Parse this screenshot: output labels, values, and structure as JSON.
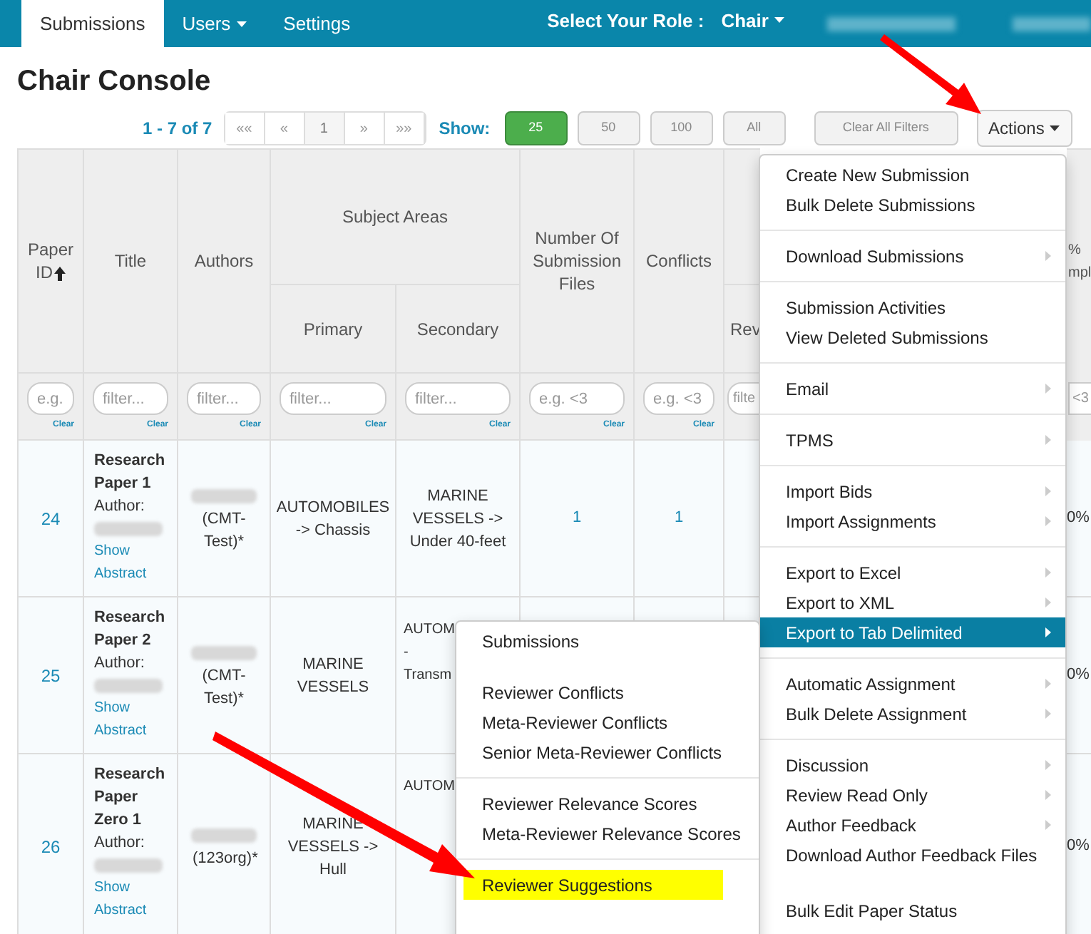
{
  "nav": {
    "tabs": [
      {
        "label": "Submissions",
        "selected": true,
        "dropdown": false
      },
      {
        "label": "Users",
        "selected": false,
        "dropdown": true
      },
      {
        "label": "Settings",
        "selected": false,
        "dropdown": false
      }
    ],
    "role_label": "Select Your Role :",
    "role_value": "Chair"
  },
  "title": "Chair Console",
  "toolbar": {
    "range": "1 - 7 of 7",
    "pager": [
      {
        "label": "««",
        "selected": false
      },
      {
        "label": "«",
        "selected": false
      },
      {
        "label": "1",
        "selected": true
      },
      {
        "label": "»",
        "selected": false
      },
      {
        "label": "»»",
        "selected": false
      }
    ],
    "show_label": "Show:",
    "sizes": [
      {
        "label": "25",
        "selected": true
      },
      {
        "label": "50",
        "selected": false
      },
      {
        "label": "100",
        "selected": false
      },
      {
        "label": "All",
        "selected": false
      }
    ],
    "clear_filters": "Clear All Filters",
    "actions": "Actions"
  },
  "table": {
    "headers": {
      "paper_id": "Paper ID",
      "title": "Title",
      "authors": "Authors",
      "subject_areas": "Subject Areas",
      "primary": "Primary",
      "secondary": "Secondary",
      "files": "Number Of Submission Files",
      "conflicts": "Conflicts",
      "column_8": "Rev"
    },
    "filters": [
      {
        "placeholder": "e.g.",
        "clear": "Clear"
      },
      {
        "placeholder": "filter...",
        "clear": "Clear"
      },
      {
        "placeholder": "filter...",
        "clear": "Clear"
      },
      {
        "placeholder": "filter...",
        "clear": "Clear"
      },
      {
        "placeholder": "filter...",
        "clear": "Clear"
      },
      {
        "placeholder": "e.g. <3",
        "clear": "Clear"
      },
      {
        "placeholder": "e.g. <3",
        "clear": "Clear"
      },
      {
        "placeholder": "filte"
      }
    ],
    "rows": [
      {
        "id": "24",
        "title": "Research Paper 1",
        "author_label": "Author:",
        "abstract_link": "Show Abstract",
        "authors_suffix": "(CMT-Test)*",
        "primary": "AUTOMOBILES -> Chassis",
        "secondary": [
          "MARINE",
          "VESSELS ->",
          "Under 40-feet"
        ],
        "secondary_covered": false,
        "files": "1",
        "conflicts": "1"
      },
      {
        "id": "25",
        "title": "Research Paper 2",
        "author_label": "Author:",
        "abstract_link": "Show Abstract",
        "authors_suffix": "(CMT-Test)*",
        "primary": "MARINE VESSELS",
        "secondary": [
          "AUTOM",
          "-",
          "Transm"
        ],
        "secondary_covered": true
      },
      {
        "id": "26",
        "title": "Research Paper Zero 1",
        "author_label": "Author:",
        "abstract_link": "Show Abstract",
        "authors_suffix": "(123org)*",
        "primary": "MARINE VESSELS -> Hull",
        "secondary": [
          "AUTOM"
        ],
        "secondary_covered": true
      }
    ],
    "column_9": {
      "header": [
        "%",
        "mpl"
      ],
      "placeholder": "<3",
      "cells": [
        "0%",
        "0%",
        "0%"
      ]
    }
  },
  "actions_menu": [
    {
      "items": [
        {
          "label": "Create New Submission",
          "submenu": false,
          "selected": false
        },
        {
          "label": "Bulk Delete Submissions",
          "submenu": false,
          "selected": false
        }
      ]
    },
    {
      "items": [
        {
          "label": "Download Submissions",
          "submenu": true,
          "selected": false
        }
      ]
    },
    {
      "items": [
        {
          "label": "Submission Activities",
          "submenu": false,
          "selected": false
        },
        {
          "label": "View Deleted Submissions",
          "submenu": false,
          "selected": false
        }
      ]
    },
    {
      "items": [
        {
          "label": "Email",
          "submenu": true,
          "selected": false
        }
      ]
    },
    {
      "items": [
        {
          "label": "TPMS",
          "submenu": true,
          "selected": false
        }
      ]
    },
    {
      "items": [
        {
          "label": "Import Bids",
          "submenu": true,
          "selected": false
        },
        {
          "label": "Import Assignments",
          "submenu": true,
          "selected": false
        }
      ]
    },
    {
      "items": [
        {
          "label": "Export to Excel",
          "submenu": true,
          "selected": false
        },
        {
          "label": "Export to XML",
          "submenu": true,
          "selected": false
        },
        {
          "label": "Export to Tab Delimited",
          "submenu": true,
          "selected": true
        }
      ]
    },
    {
      "items": [
        {
          "label": "Automatic Assignment",
          "submenu": true,
          "selected": false
        },
        {
          "label": "Bulk Delete Assignment",
          "submenu": true,
          "selected": false
        }
      ]
    },
    {
      "items": [
        {
          "label": "Discussion",
          "submenu": true,
          "selected": false
        },
        {
          "label": "Review Read Only",
          "submenu": true,
          "selected": false
        },
        {
          "label": "Author Feedback",
          "submenu": true,
          "selected": false
        },
        {
          "label": "Download Author Feedback Files",
          "submenu": false,
          "selected": false
        }
      ]
    },
    {
      "items": [
        {
          "label": "Bulk Edit Paper Status",
          "submenu": false,
          "selected": false
        }
      ]
    }
  ],
  "export_submenu": [
    {
      "divider": false,
      "items": [
        {
          "label": "Submissions",
          "highlighted": false
        }
      ]
    },
    {
      "divider": false,
      "items": [
        {
          "label": "Reviewer Conflicts",
          "highlighted": false
        },
        {
          "label": "Meta-Reviewer Conflicts",
          "highlighted": false
        },
        {
          "label": "Senior Meta-Reviewer Conflicts",
          "highlighted": false
        }
      ]
    },
    {
      "divider": true,
      "items": [
        {
          "label": "Reviewer Relevance Scores",
          "highlighted": false
        },
        {
          "label": "Meta-Reviewer Relevance Scores",
          "highlighted": false
        }
      ]
    },
    {
      "divider": true,
      "items": [
        {
          "label": "Reviewer Suggestions",
          "highlighted": true
        }
      ]
    }
  ]
}
